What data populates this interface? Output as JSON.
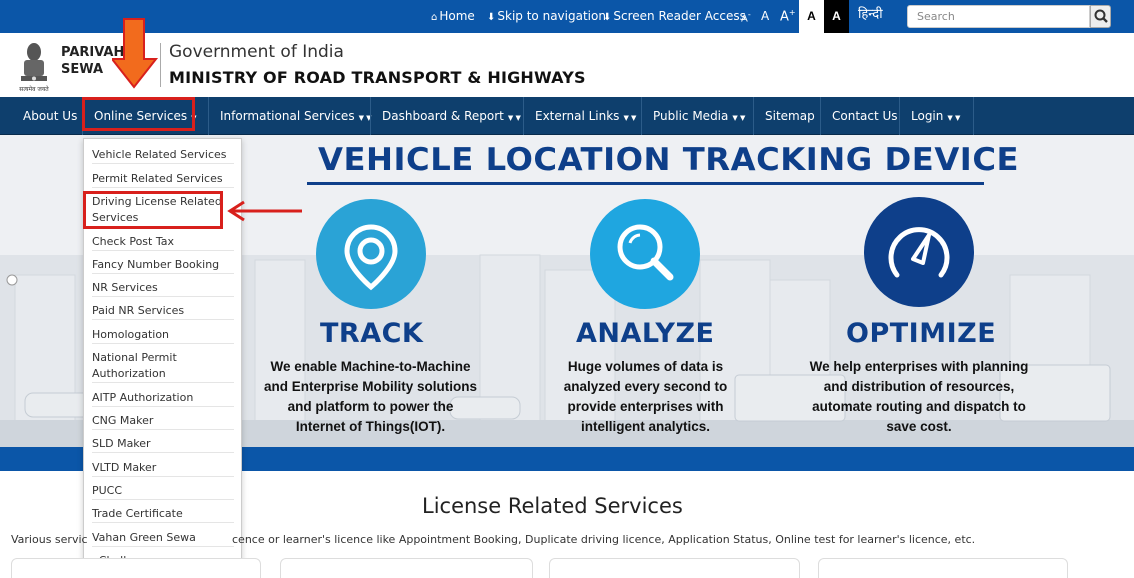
{
  "top_bar": {
    "home": "Home",
    "skip": "Skip to navigation",
    "screen_reader": "Screen Reader Access",
    "font_decrease": "A",
    "font_normal": "A",
    "font_increase": "A",
    "font_increase_sup": "+",
    "contrast_light": "A",
    "contrast_dark": "A",
    "language": "हिन्दी",
    "search_placeholder": "Search"
  },
  "header": {
    "emblem_motto": "सत्यमेव जयते",
    "brand_line1": "PARIVAH",
    "brand_line2": "SEWA",
    "government": "Government of India",
    "ministry": "MINISTRY OF ROAD TRANSPORT & HIGHWAYS"
  },
  "nav": [
    {
      "label": "About Us",
      "caret": false
    },
    {
      "label": "Online Services",
      "caret": true
    },
    {
      "label": "Informational Services",
      "caret": true
    },
    {
      "label": "Dashboard & Report",
      "caret": true
    },
    {
      "label": "External Links",
      "caret": true
    },
    {
      "label": "Public Media",
      "caret": true
    },
    {
      "label": "Sitemap",
      "caret": false
    },
    {
      "label": "Contact Us",
      "caret": false
    },
    {
      "label": "Login",
      "caret": true
    }
  ],
  "dropdown_items": [
    "Vehicle Related Services",
    "Permit Related Services",
    "Driving License Related Services",
    "Check Post Tax",
    "Fancy Number Booking",
    "NR Services",
    "Paid NR Services",
    "Homologation",
    "National Permit Authorization",
    "AITP Authorization",
    "CNG Maker",
    "SLD Maker",
    "VLTD Maker",
    "PUCC",
    "Trade Certificate",
    "Vahan Green Sewa",
    "eChallan"
  ],
  "banner": {
    "title": "VEHICLE LOCATION TRACKING DEVICE",
    "features": [
      {
        "heading": "TRACK",
        "text": "We enable Machine-to-Machine and Enterprise Mobility solutions and platform to power the Internet of Things(IOT).",
        "color": "#2aa3d6",
        "icon": "location-pin-icon"
      },
      {
        "heading": "ANALYZE",
        "text": "Huge volumes of data is analyzed every second to provide enterprises with intelligent analytics.",
        "color": "#1fa6e0",
        "icon": "magnifier-icon"
      },
      {
        "heading": "OPTIMIZE",
        "text": "We help enterprises with planning and distribution of resources, automate routing and dispatch to save cost.",
        "color": "#0e3f8a",
        "icon": "gauge-icon"
      }
    ]
  },
  "section": {
    "heading": "License Related Services",
    "desc_left": "Various servic",
    "desc": "cence or learner's licence like Appointment Booking, Duplicate driving licence, Application Status, Online test for learner's licence, etc."
  },
  "colors": {
    "topbar": "#0b56a8",
    "navbar": "#0e3f6d",
    "highlight": "#d8201c",
    "arrow": "#f26b1d"
  }
}
